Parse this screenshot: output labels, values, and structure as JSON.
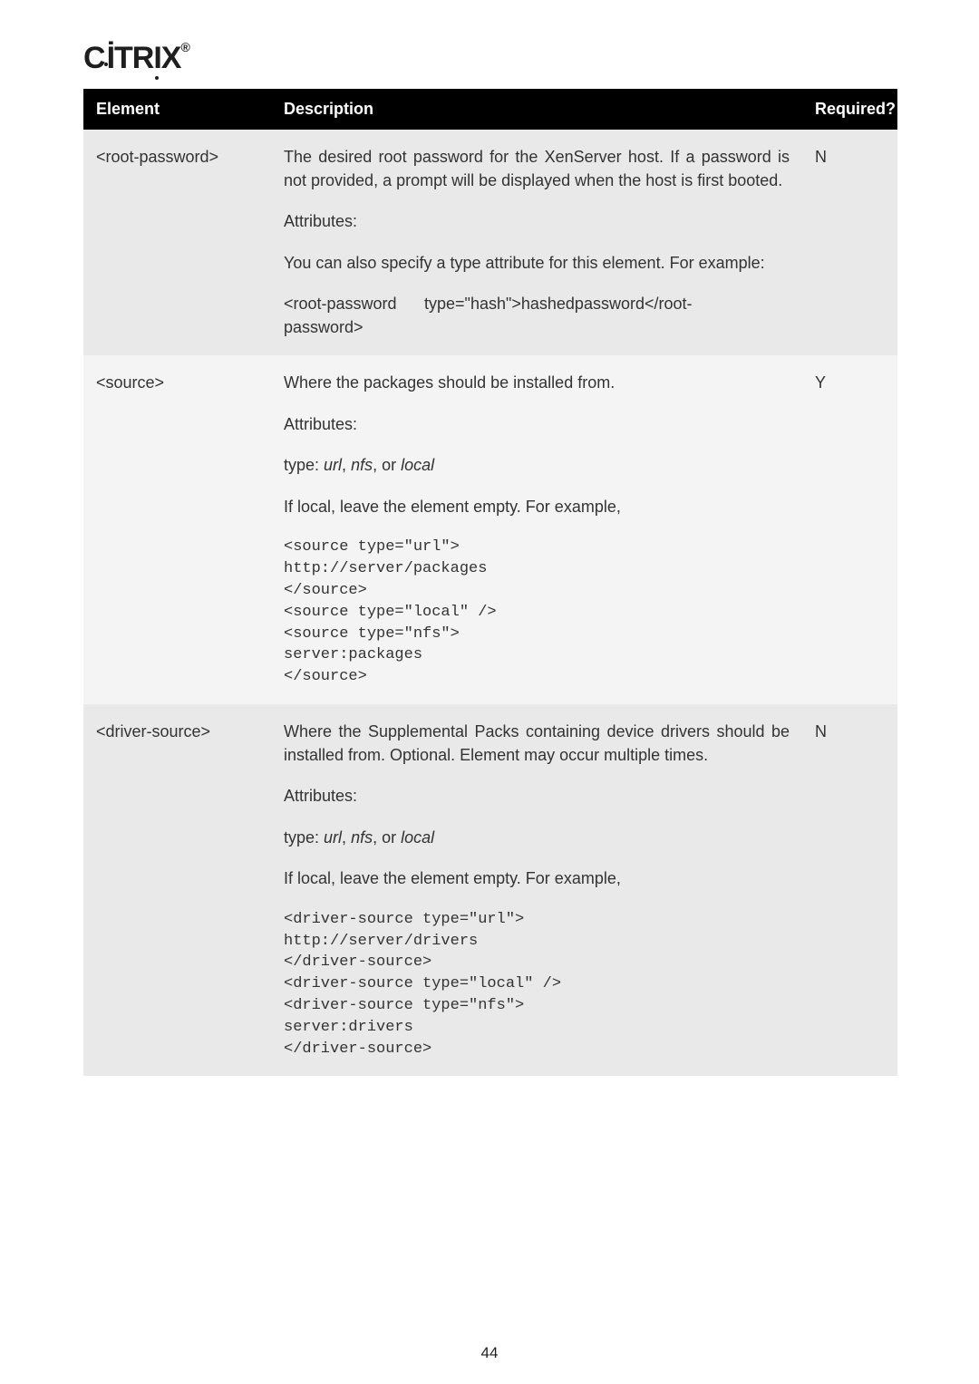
{
  "logo": "CITRIX",
  "page_number": "44",
  "headers": {
    "element": "Element",
    "description": "Description",
    "required": "Required?"
  },
  "rows": [
    {
      "element": "<root-password>",
      "required": "N",
      "desc_p1": "The desired root password for the XenServer host. If a password is not provided, a prompt will be displayed when the host is first booted.",
      "desc_attr": "Attributes:",
      "desc_p2": "You can also specify a type attribute for this element. For example:",
      "desc_code_open": "<root-password",
      "desc_code_mid": "type=\"hash\">hashedpassword</root-",
      "desc_code_close": "password>"
    },
    {
      "element": "<source>",
      "required": "Y",
      "desc_p1": "Where the packages should be installed from.",
      "desc_attr": "Attributes:",
      "desc_type_prefix": "type: ",
      "desc_type_url": "url",
      "desc_type_sep1": ", ",
      "desc_type_nfs": "nfs",
      "desc_type_sep2": ", or ",
      "desc_type_local": "local",
      "desc_p2": "If local, leave the element empty. For example,",
      "code": "<source type=\"url\">\nhttp://server/packages\n</source>\n<source type=\"local\" />\n<source type=\"nfs\">\nserver:packages\n</source>"
    },
    {
      "element": "<driver-source>",
      "required": "N",
      "desc_p1": "Where the Supplemental Packs containing device drivers should be installed from. Optional. Element may occur multiple times.",
      "desc_attr": "Attributes:",
      "desc_type_prefix": "type: ",
      "desc_type_url": "url",
      "desc_type_sep1": ", ",
      "desc_type_nfs": "nfs",
      "desc_type_sep2": ", or ",
      "desc_type_local": "local",
      "desc_p2": "If local, leave the element empty. For example,",
      "code": "<driver-source type=\"url\">\nhttp://server/drivers\n</driver-source>\n<driver-source type=\"local\" />\n<driver-source type=\"nfs\">\nserver:drivers\n</driver-source>"
    }
  ]
}
